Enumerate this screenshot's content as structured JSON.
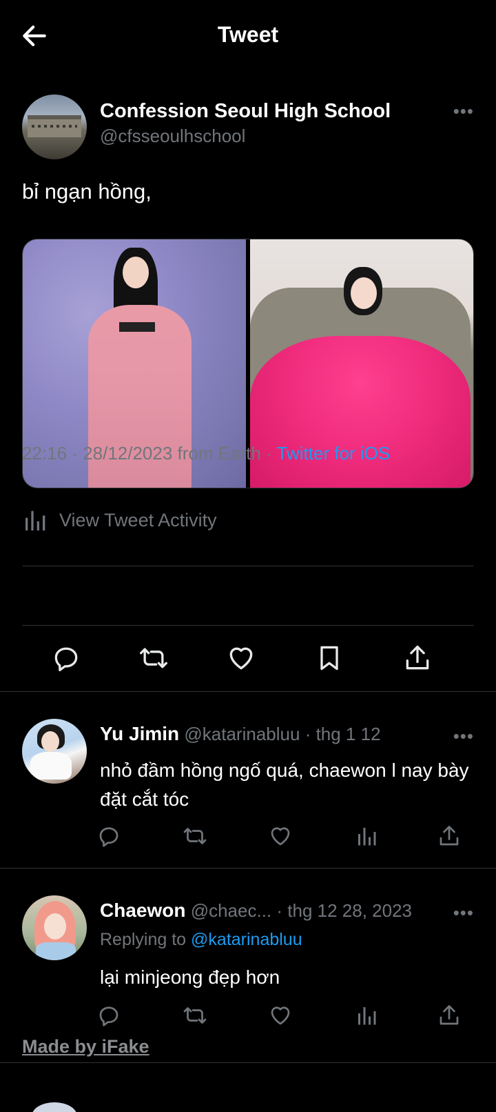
{
  "header": {
    "title": "Tweet",
    "back_icon": "arrow-left-icon"
  },
  "tweet": {
    "display_name": "Confession Seoul High School",
    "handle": "@cfsseoulhschool",
    "text": "bỉ ngạn hồng,",
    "timestamp": "22:16 · 28/12/2023 from Earth",
    "separator": " · ",
    "source": "Twitter for iOS",
    "activity_label": "View Tweet Activity",
    "media_count": 2
  },
  "replies": [
    {
      "display_name": "Yu Jimin",
      "handle": "@katarinabluu",
      "time": "· thg 1 12",
      "text": "nhỏ đầm hồng ngố quá, chaewon l nay bày đặt cắt tóc"
    },
    {
      "display_name": "Chaewon",
      "handle": "@chaec...",
      "time": "· thg 12 28, 2023",
      "replying_prefix": "Replying to ",
      "replying_to": "@katarinabluu",
      "text": "lại minjeong đẹp hơn"
    }
  ],
  "watermark": "Made by iFake",
  "colors": {
    "background": "#000000",
    "accent": "#1d9bf0",
    "muted": "#71767b",
    "divider": "#2f3336"
  }
}
